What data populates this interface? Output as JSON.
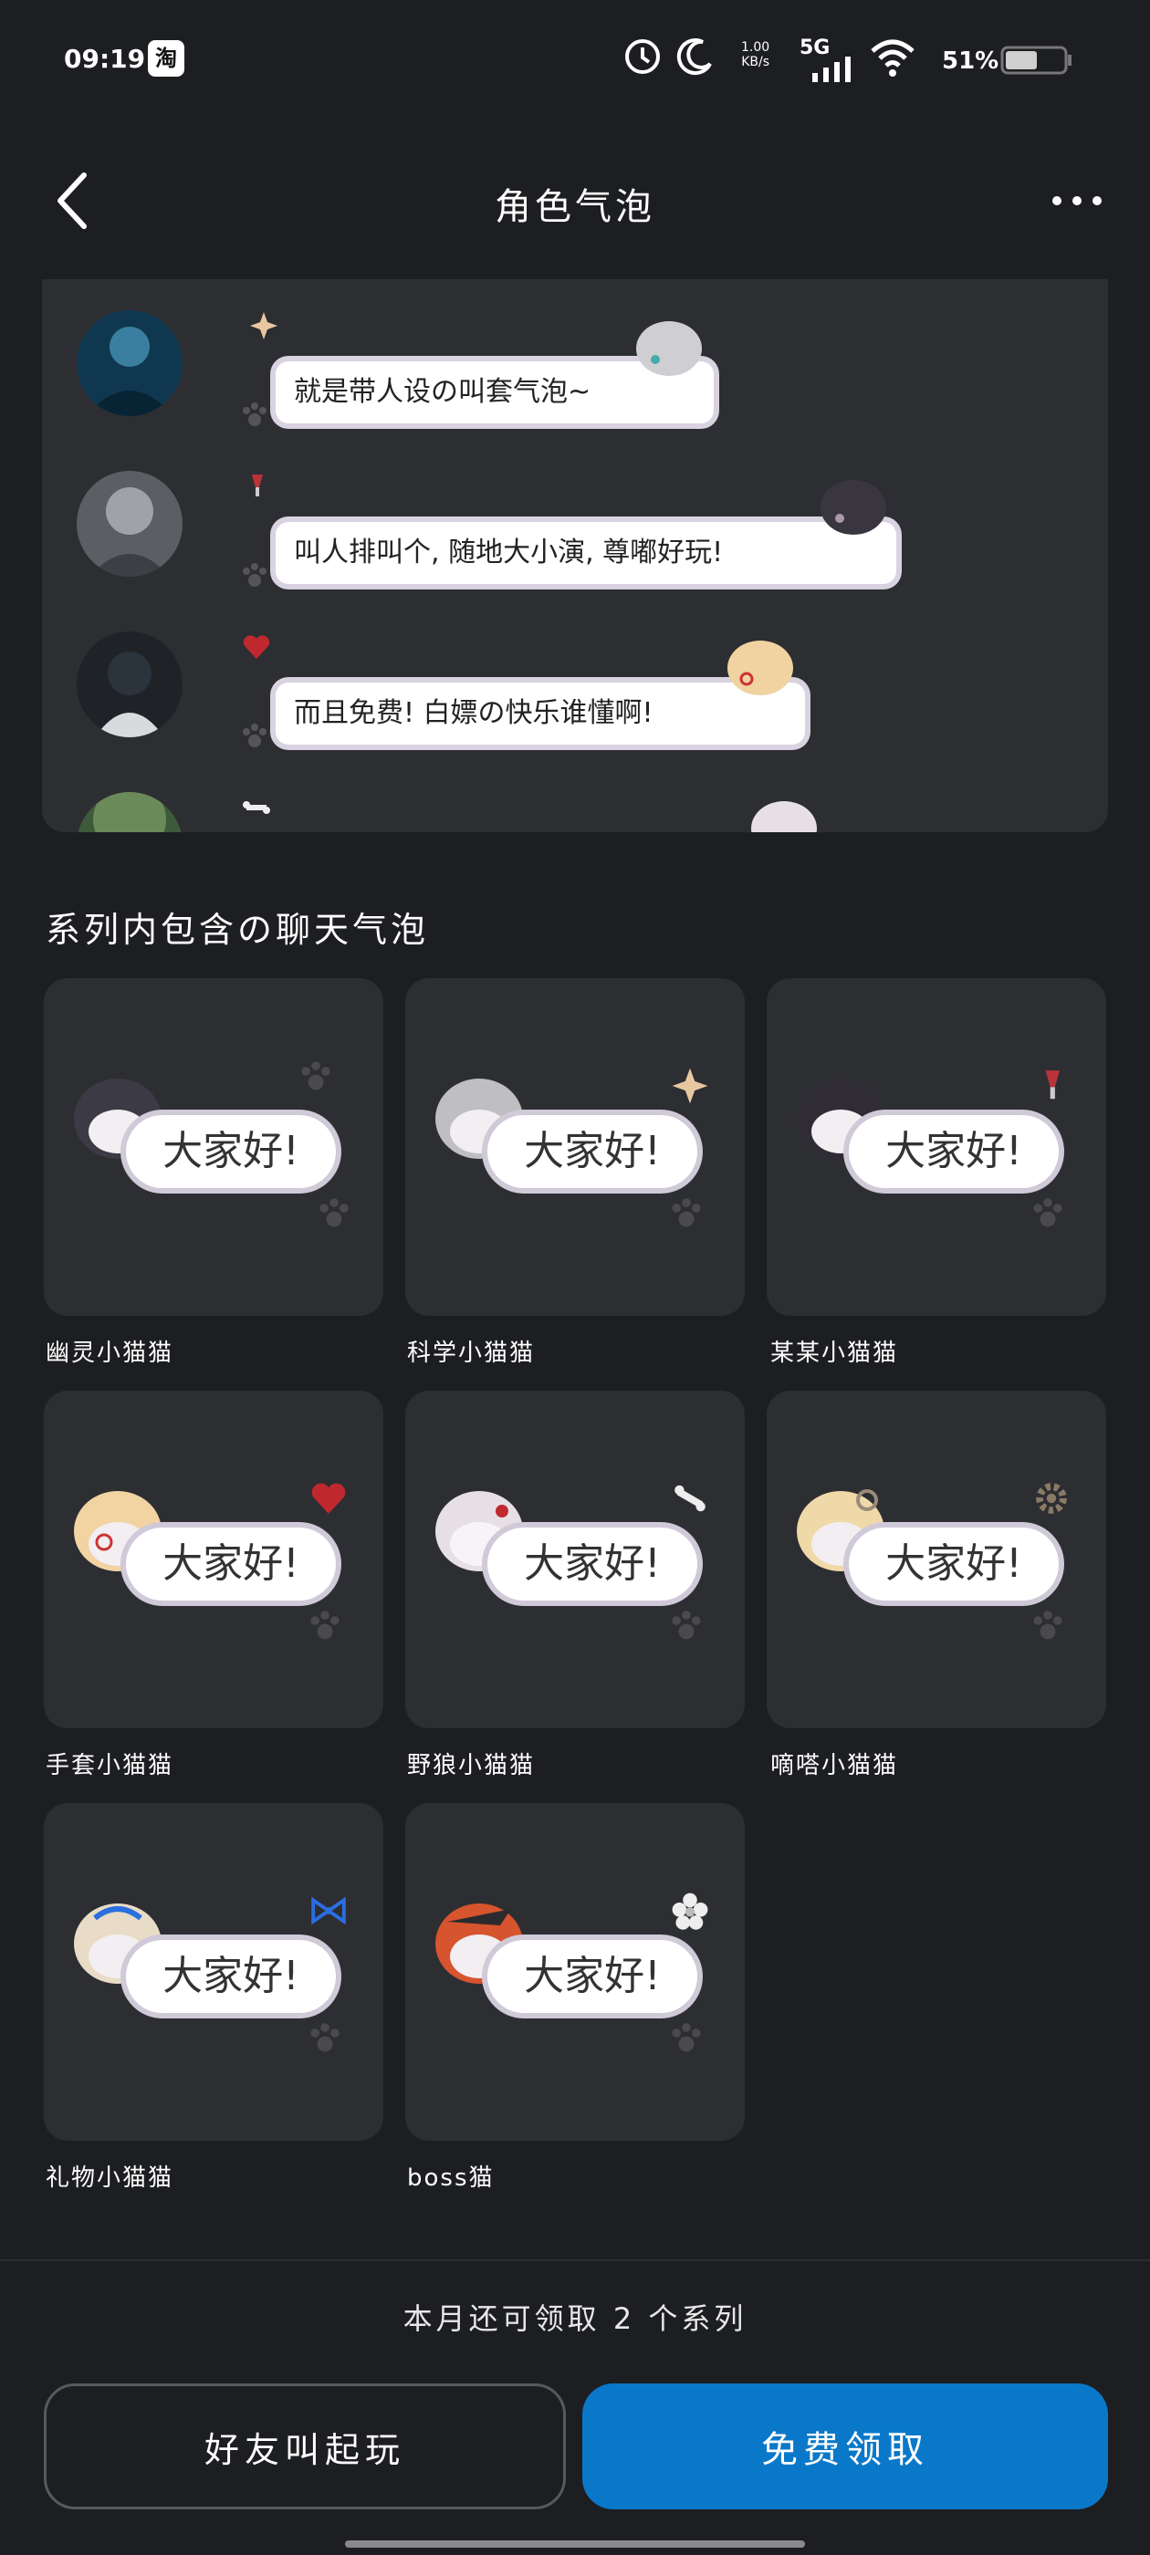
{
  "status_bar": {
    "time": "09:19",
    "app_badge": "淘",
    "net_speed_top": "1.00",
    "net_speed_bottom": "KB/s",
    "signal": "5G",
    "battery": "51%"
  },
  "header": {
    "title": "角色气泡",
    "back_icon": "chevron-left-icon",
    "more_icon": "more-horizontal-icon"
  },
  "preview": {
    "messages": [
      {
        "text": "就是带人设の叫套气泡~"
      },
      {
        "text": "叫人排叫个, 随地大小演, 尊嘟好玩!"
      },
      {
        "text": "而且免费! 白嫖の快乐谁懂啊!"
      },
      {
        "text": ""
      }
    ]
  },
  "section": {
    "title": "系列内包含の聊天气泡"
  },
  "bubbles": [
    {
      "name": "幽灵小猫猫",
      "sample": "大家好!",
      "hair": "#3c3a44",
      "accessory": "none"
    },
    {
      "name": "科学小猫猫",
      "sample": "大家好!",
      "hair": "#bfbfc1",
      "accessory": "sparkle-icon"
    },
    {
      "name": "某某小猫猫",
      "sample": "大家好!",
      "hair": "#2f2c36",
      "accessory": "wine-glass-icon"
    },
    {
      "name": "手套小猫猫",
      "sample": "大家好!",
      "hair": "#f2d3a2",
      "accessory": "heart-icon"
    },
    {
      "name": "野狼小猫猫",
      "sample": "大家好!",
      "hair": "#e6e0e4",
      "accessory": "bone-icon"
    },
    {
      "name": "嘀嗒小猫猫",
      "sample": "大家好!",
      "hair": "#f0d9a8",
      "accessory": "gear-icon"
    },
    {
      "name": "礼物小猫猫",
      "sample": "大家好!",
      "hair": "#e9dcc6",
      "accessory": "ribbon-icon"
    },
    {
      "name": "boss猫",
      "sample": "大家好!",
      "hair": "#d6542e",
      "accessory": "flower-icon"
    }
  ],
  "footer": {
    "quota_text": "本月还可领取 2 个系列",
    "friends_button": "好友叫起玩",
    "claim_button": "免费领取"
  },
  "colors": {
    "background": "#1d1e21",
    "card": "#2d2e32",
    "primary_button": "#0a78c9"
  }
}
